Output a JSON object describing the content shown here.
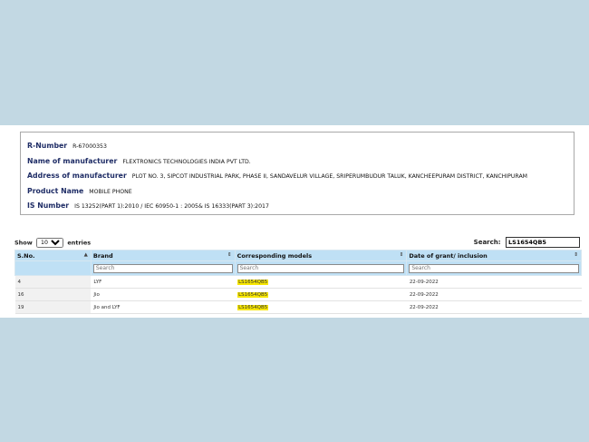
{
  "info": {
    "r_number_label": "R-Number",
    "r_number_value": "R-67000353",
    "manufacturer_label": "Name of manufacturer",
    "manufacturer_value": "FLEXTRONICS TECHNOLOGIES INDIA PVT LTD.",
    "address_label": "Address of manufacturer",
    "address_value": "PLOT NO. 3, SIPCOT INDUSTRIAL PARK, PHASE II, SANDAVELUR VILLAGE, SRIPERUMBUDUR TALUK, KANCHEEPURAM DISTRICT, KANCHIPURAM",
    "product_label": "Product Name",
    "product_value": "MOBILE PHONE",
    "is_label": "IS Number",
    "is_value": "IS 13252(PART 1):2010 / IEC 60950-1 : 2005& IS 16333(PART 3):2017"
  },
  "controls": {
    "show_label": "Show",
    "entries_value": "10",
    "entries_label": "entries",
    "search_label": "Search:",
    "search_value": "LS1654QB5"
  },
  "table": {
    "columns": [
      "S.No.",
      "Brand",
      "Corresponding models",
      "Date of grant/ inclusion"
    ],
    "filter_placeholder": "Search",
    "rows": [
      {
        "sno": "4",
        "brand": "LYF",
        "model": "LS1654QB5",
        "date": "22-09-2022"
      },
      {
        "sno": "16",
        "brand": "Jio",
        "model": "LS1654QB5",
        "date": "22-09-2022"
      },
      {
        "sno": "19",
        "brand": "Jio and LYF",
        "model": "LS1654QB5",
        "date": "22-09-2022"
      }
    ]
  },
  "icons": {
    "sort_asc": "sort-asc-icon",
    "sort_both": "sort-both-icon"
  }
}
